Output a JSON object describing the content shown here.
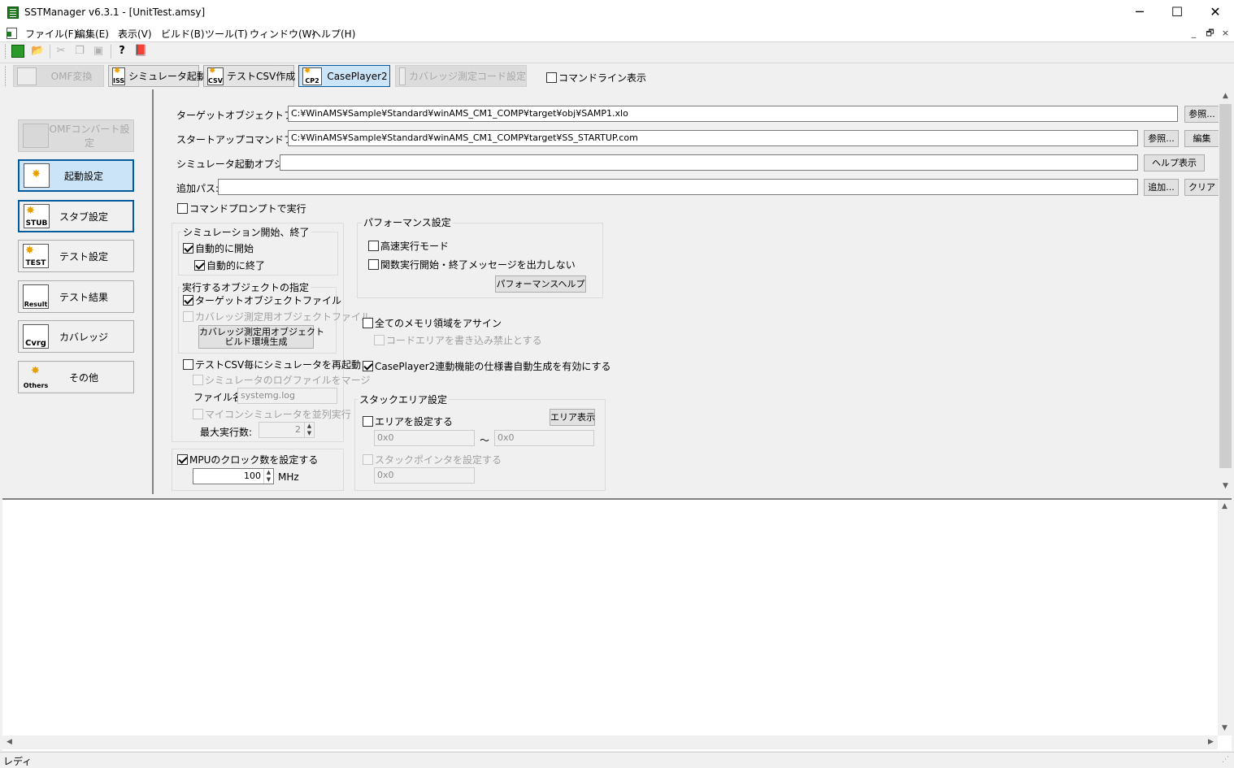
{
  "window": {
    "title": "SSTManager v6.3.1 - [UnitTest.amsy]",
    "minimize": "─",
    "maximize": "☐",
    "close": "✕"
  },
  "menu": [
    "ファイル(F)",
    "編集(E)",
    "表示(V)",
    "ビルド(B)",
    "ツール(T)",
    "ウィンドウ(W)",
    "ヘルプ(H)"
  ],
  "mdi_controls": [
    "_",
    "🗗",
    "×"
  ],
  "toolbar_buttons": [
    {
      "label": "OMF変換",
      "icon": "omf-icon",
      "enabled": false
    },
    {
      "label": "シミュレータ起動",
      "icon": "ISS",
      "enabled": true
    },
    {
      "label": "テストCSV作成",
      "icon": "CSV",
      "enabled": true
    },
    {
      "label": "CasePlayer2",
      "icon": "CP2",
      "enabled": true,
      "selected": true
    },
    {
      "label": "カバレッジ測定コード設定",
      "icon": "cov-code-icon",
      "enabled": false
    }
  ],
  "toolbar_cmdline_label": "コマンドライン表示",
  "nav": [
    {
      "label": "OMFコンバート設定",
      "icon": "",
      "enabled": false
    },
    {
      "label": "起動設定",
      "icon": "",
      "selected": true
    },
    {
      "label": "スタブ設定",
      "icon": "STUB"
    },
    {
      "label": "テスト設定",
      "icon": "TEST"
    },
    {
      "label": "テスト結果",
      "icon": "Result"
    },
    {
      "label": "カバレッジ",
      "icon": "Cvrg"
    },
    {
      "label": "その他",
      "icon": "Others"
    }
  ],
  "form": {
    "target_label": "ターゲットオブジェクトファイル:",
    "target_value": "C:¥WinAMS¥Sample¥Standard¥winAMS_CM1_COMP¥target¥obj¥SAMP1.xlo",
    "browse": "参照...",
    "startup_label": "スタートアップコマンドファイル:",
    "startup_value": "C:¥WinAMS¥Sample¥Standard¥winAMS_CM1_COMP¥target¥SS_STARTUP.com",
    "edit": "編集",
    "sim_option_label": "シミュレータ起動オプション:",
    "sim_option_value": "",
    "help_show": "ヘルプ表示",
    "addpath_label": "追加パス:",
    "addpath_value": "",
    "add": "追加...",
    "clear": "クリア",
    "cmd_prompt": "コマンドプロンプトで実行"
  },
  "sim_group": {
    "title": "シミュレーション開始、終了",
    "auto_start": "自動的に開始",
    "auto_end": "自動的に終了"
  },
  "obj_group": {
    "title": "実行するオブジェクトの指定",
    "target_obj": "ターゲットオブジェクトファイル",
    "cov_obj": "カバレッジ測定用オブジェクトファイル",
    "build_btn_line1": "カバレッジ測定用オブジェクト",
    "build_btn_line2": "ビルド環境生成"
  },
  "restart": {
    "label": "テストCSV毎にシミュレータを再起動",
    "merge_log": "シミュレータのログファイルをマージ",
    "filename_label": "ファイル名:",
    "filename_value": "systemg.log",
    "parallel": "マイコンシミュレータを並列実行",
    "max_label": "最大実行数:",
    "max_value": "2"
  },
  "mpu": {
    "label": "MPUのクロック数を設定する",
    "value": "100",
    "unit": "MHz"
  },
  "perf": {
    "title": "パフォーマンス設定",
    "fast": "高速実行モード",
    "no_msg": "関数実行開始・終了メッセージを出力しない",
    "help": "パフォーマンスヘルプ"
  },
  "memory": {
    "assign_all": "全てのメモリ領域をアサイン",
    "code_protect": "コードエリアを書き込み禁止とする"
  },
  "caseplayer": "CasePlayer2連動機能の仕様書自動生成を有効にする",
  "stack": {
    "title": "スタックエリア設定",
    "set_area": "エリアを設定する",
    "show_area": "エリア表示",
    "from": "0x0",
    "tilde": "～",
    "to": "0x0",
    "set_sp": "スタックポインタを設定する",
    "sp_value": "0x0"
  },
  "status": "レディ"
}
